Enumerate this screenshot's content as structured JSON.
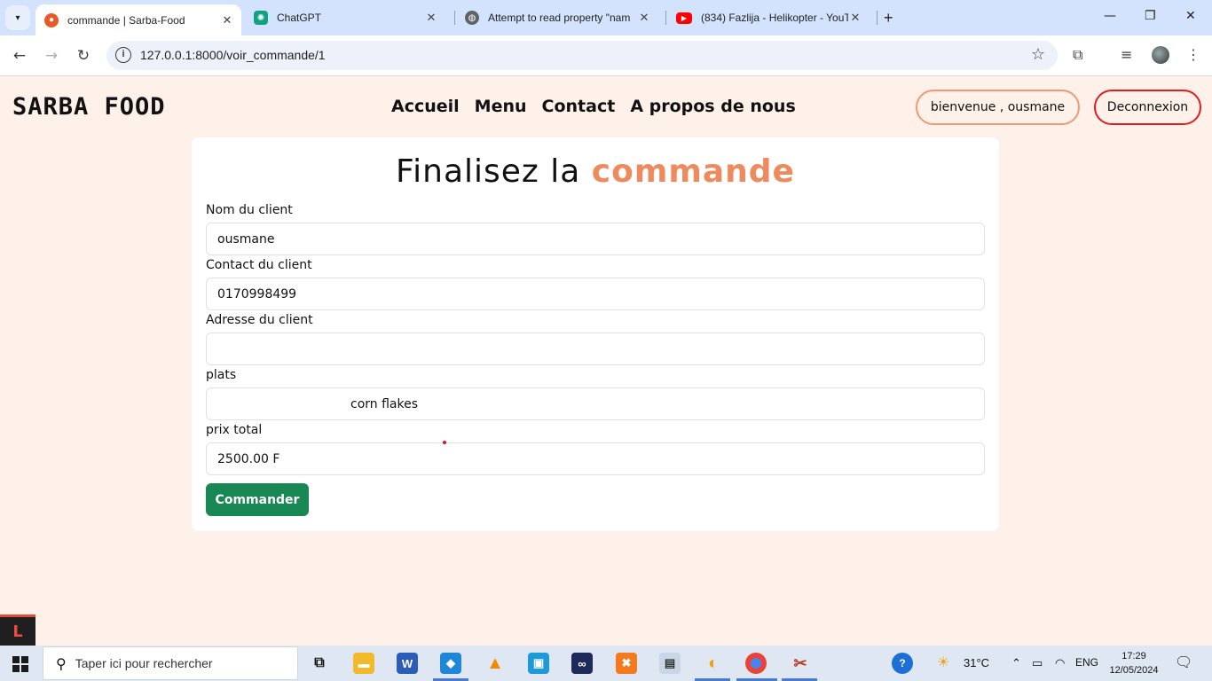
{
  "browser": {
    "tabs": [
      {
        "title": "commande | Sarba-Food",
        "active": true
      },
      {
        "title": "ChatGPT",
        "active": false
      },
      {
        "title": "Attempt to read property \"nam",
        "active": false
      },
      {
        "title": "(834) Fazlija - Helikopter - YouTu",
        "active": false
      }
    ],
    "url": "127.0.0.1:8000/voir_commande/1"
  },
  "header": {
    "brand": "SARBA FOOD",
    "nav": [
      "Accueil",
      "Menu",
      "Contact",
      "A propos de nous"
    ],
    "welcome": "bienvenue , ousmane",
    "logout": "Deconnexion"
  },
  "form": {
    "title_prefix": "Finalisez la",
    "title_accent": "commande",
    "fields": [
      {
        "label": "Nom du client",
        "value": "ousmane"
      },
      {
        "label": "Contact du client",
        "value": "0170998499"
      },
      {
        "label": "Adresse du client",
        "value": ""
      },
      {
        "label": "plats",
        "value": "corn flakes"
      },
      {
        "label": "prix total",
        "value": "2500.00 F"
      }
    ],
    "submit": "Commander"
  },
  "taskbar": {
    "search_placeholder": "Taper ici pour rechercher",
    "weather": "31°C",
    "language": "ENG",
    "time": "17:29",
    "date": "12/05/2024"
  },
  "colors": {
    "accent": "#ef8a5e",
    "page_bg": "#fdf1ea",
    "submit_green": "#198754",
    "logout_border": "#e01e1e"
  }
}
